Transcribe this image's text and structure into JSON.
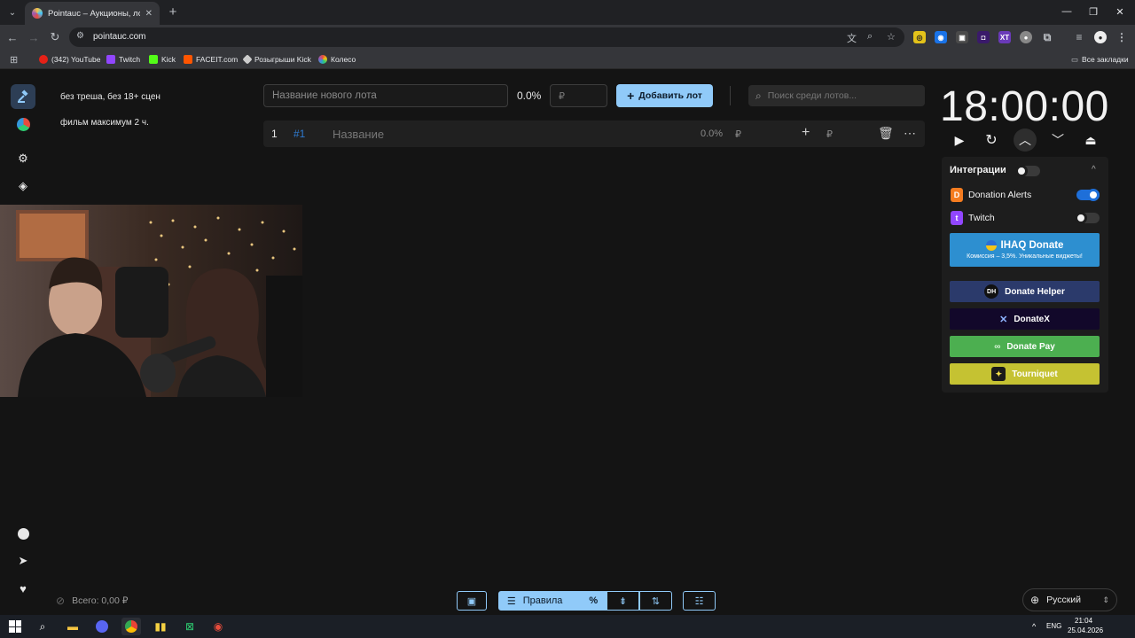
{
  "browser": {
    "tab_title": "Pointauc – Аукционы, лотереи",
    "url": "pointauc.com",
    "bookmarks": [
      {
        "label": "(342) YouTube",
        "color": "#e62117"
      },
      {
        "label": "Twitch",
        "color": "#9146ff"
      },
      {
        "label": "Kick",
        "color": "#53fc18"
      },
      {
        "label": "FACEIT.com",
        "color": "#ff5500"
      },
      {
        "label": "Розыгрыши Kick",
        "color": "#cccccc"
      },
      {
        "label": "Колесо",
        "color": "#e74c3c"
      }
    ],
    "all_bookmarks": "Все закладки"
  },
  "rules": {
    "line1": "без треша, без 18+ сцен",
    "line2": "фильм максимум 2 ч."
  },
  "lot_form": {
    "name_placeholder": "Название нового лота",
    "percent": "0.0%",
    "amount_placeholder": "₽",
    "add_label": "Добавить лот",
    "search_placeholder": "Поиск среди лотов..."
  },
  "lots": [
    {
      "index": "1",
      "id": "#1",
      "name_placeholder": "Название",
      "percent": "0.0%",
      "currency": "₽",
      "amount_currency": "₽"
    }
  ],
  "timer": {
    "value": "18:00:00"
  },
  "integrations": {
    "title": "Интеграции",
    "enabled": false,
    "items": [
      {
        "label": "Donation Alerts",
        "enabled": true,
        "color": "#f57c20"
      },
      {
        "label": "Twitch",
        "enabled": false,
        "color": "#9146ff"
      }
    ],
    "ihaq": {
      "title": "IHAQ Donate",
      "subtitle": "Комиссия – 3,5%. Уникальные виджеты!"
    },
    "services": [
      {
        "label": "Donate Helper",
        "color": "#2b3a6b"
      },
      {
        "label": "DonateX",
        "color": "#12082a"
      },
      {
        "label": "Donate Pay",
        "color": "#4caf50"
      },
      {
        "label": "Tourniquet",
        "color": "#c5c232"
      }
    ]
  },
  "footer": {
    "total": "Всего: 0,00 ₽",
    "rules_label": "Правила",
    "language": "Русский"
  },
  "taskbar": {
    "lang": "ENG",
    "time": "21:04",
    "date": "25.04.2026"
  }
}
